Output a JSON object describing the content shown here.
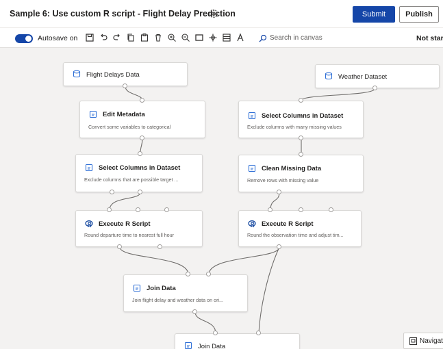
{
  "header": {
    "title": "Sample 6: Use custom R script - Flight Delay Prediction",
    "submit_label": "Submit",
    "publish_label": "Publish"
  },
  "toolbar": {
    "autosave_label": "Autosave on",
    "autosave_on": true,
    "search_placeholder": "Search in canvas",
    "status": "Not starte"
  },
  "colors": {
    "accent": "#1546a8",
    "canvas_bg": "#f3f2f1",
    "node_icon": "#2f6fd6",
    "r_icon": "#1e4fa3"
  },
  "canvas": {
    "nodes": {
      "flight_delays": {
        "title": "Flight Delays Data",
        "icon": "dataset-icon"
      },
      "weather": {
        "title": "Weather Dataset",
        "icon": "dataset-icon"
      },
      "edit_metadata": {
        "title": "Edit Metadata",
        "desc": "Convert some variables to categorical",
        "icon": "module-icon"
      },
      "select_cols_right": {
        "title": "Select Columns in Dataset",
        "desc": "Exclude columns with many missing values",
        "icon": "module-icon"
      },
      "select_cols_left": {
        "title": "Select Columns in Dataset",
        "desc": "Exclude columns that are possible target ...",
        "icon": "module-icon"
      },
      "clean_missing": {
        "title": "Clean Missing Data",
        "desc": "Remove rows with missing value",
        "icon": "module-icon"
      },
      "r_script_left": {
        "title": "Execute R Script",
        "desc": "Round departure time to nearest full hour",
        "icon": "r-icon"
      },
      "r_script_right": {
        "title": "Execute R Script",
        "desc": "Round the observation time and adjust tim...",
        "icon": "r-icon"
      },
      "join_data_1": {
        "title": "Join Data",
        "desc": "Join flight delay and weather data on ori...",
        "icon": "module-icon"
      },
      "join_data_2": {
        "title": "Join Data",
        "icon": "module-icon"
      }
    }
  },
  "navigator": {
    "label": "Navigator"
  }
}
